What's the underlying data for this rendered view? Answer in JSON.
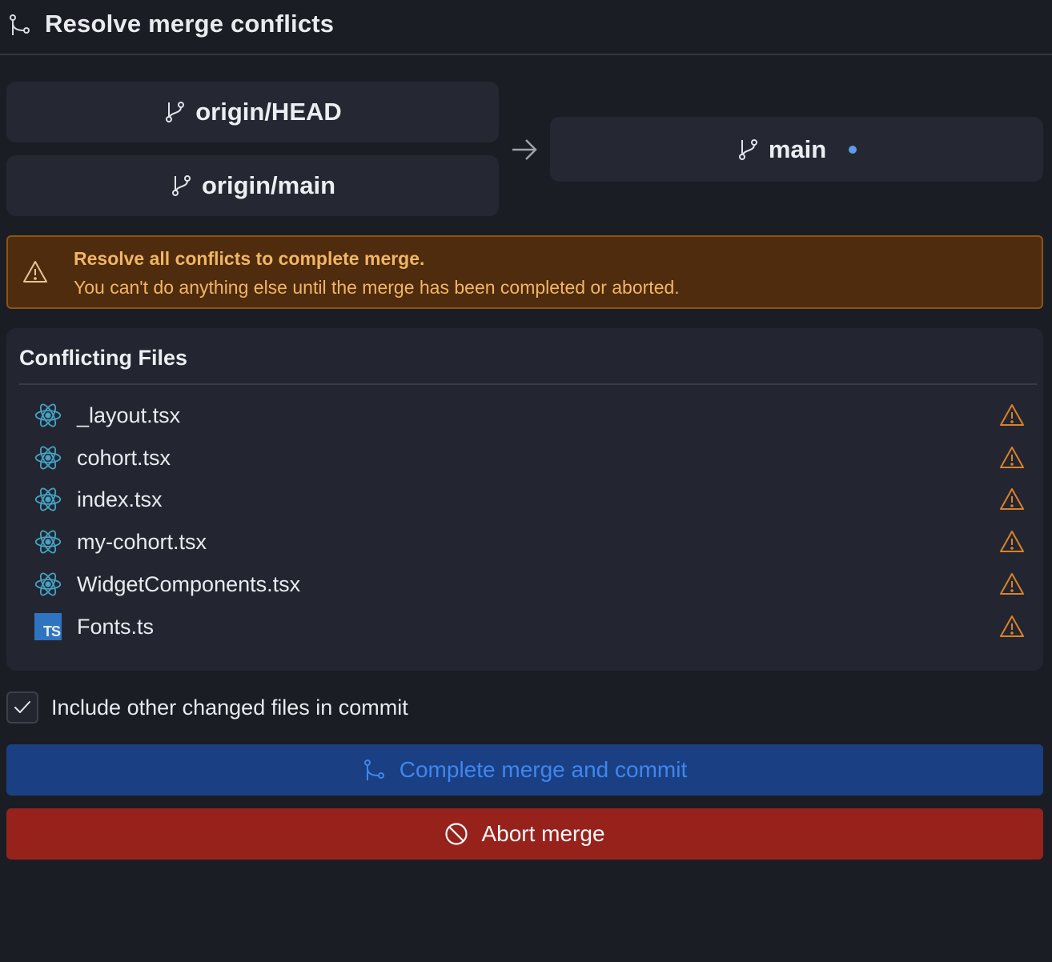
{
  "header": {
    "title": "Resolve merge conflicts",
    "icon": "git-merge-icon"
  },
  "merge": {
    "sources": [
      {
        "label": "origin/HEAD",
        "icon": "git-branch-icon"
      },
      {
        "label": "origin/main",
        "icon": "git-branch-icon"
      }
    ],
    "arrow_icon": "arrow-right-icon",
    "target": {
      "label": "main",
      "icon": "git-branch-icon",
      "status_dot_color": "#5e9be8"
    }
  },
  "warning": {
    "icon": "warning-icon",
    "title": "Resolve all conflicts to complete merge.",
    "message": "You can't do anything else until the merge has been completed or aborted."
  },
  "conflicts": {
    "title": "Conflicting Files",
    "files": [
      {
        "name": "_layout.tsx",
        "type": "react",
        "status_icon": "warning-icon"
      },
      {
        "name": "cohort.tsx",
        "type": "react",
        "status_icon": "warning-icon"
      },
      {
        "name": "index.tsx",
        "type": "react",
        "status_icon": "warning-icon"
      },
      {
        "name": "my-cohort.tsx",
        "type": "react",
        "status_icon": "warning-icon"
      },
      {
        "name": "WidgetComponents.tsx",
        "type": "react",
        "status_icon": "warning-icon"
      },
      {
        "name": "Fonts.ts",
        "type": "typescript",
        "badge": "TS",
        "status_icon": "warning-icon"
      }
    ]
  },
  "include_other": {
    "label": "Include other changed files in commit",
    "checked": true
  },
  "actions": {
    "commit_label": "Complete merge and commit",
    "abort_label": "Abort merge"
  },
  "colors": {
    "background": "#1a1d24",
    "warning_bg": "#4e2c0d",
    "warning_text": "#f2b565",
    "warning_icon": "#d9822b",
    "react_icon": "#45a3c4",
    "commit_bg": "#1a3f82",
    "commit_text": "#3f86ee",
    "abort_bg": "#97221c"
  }
}
